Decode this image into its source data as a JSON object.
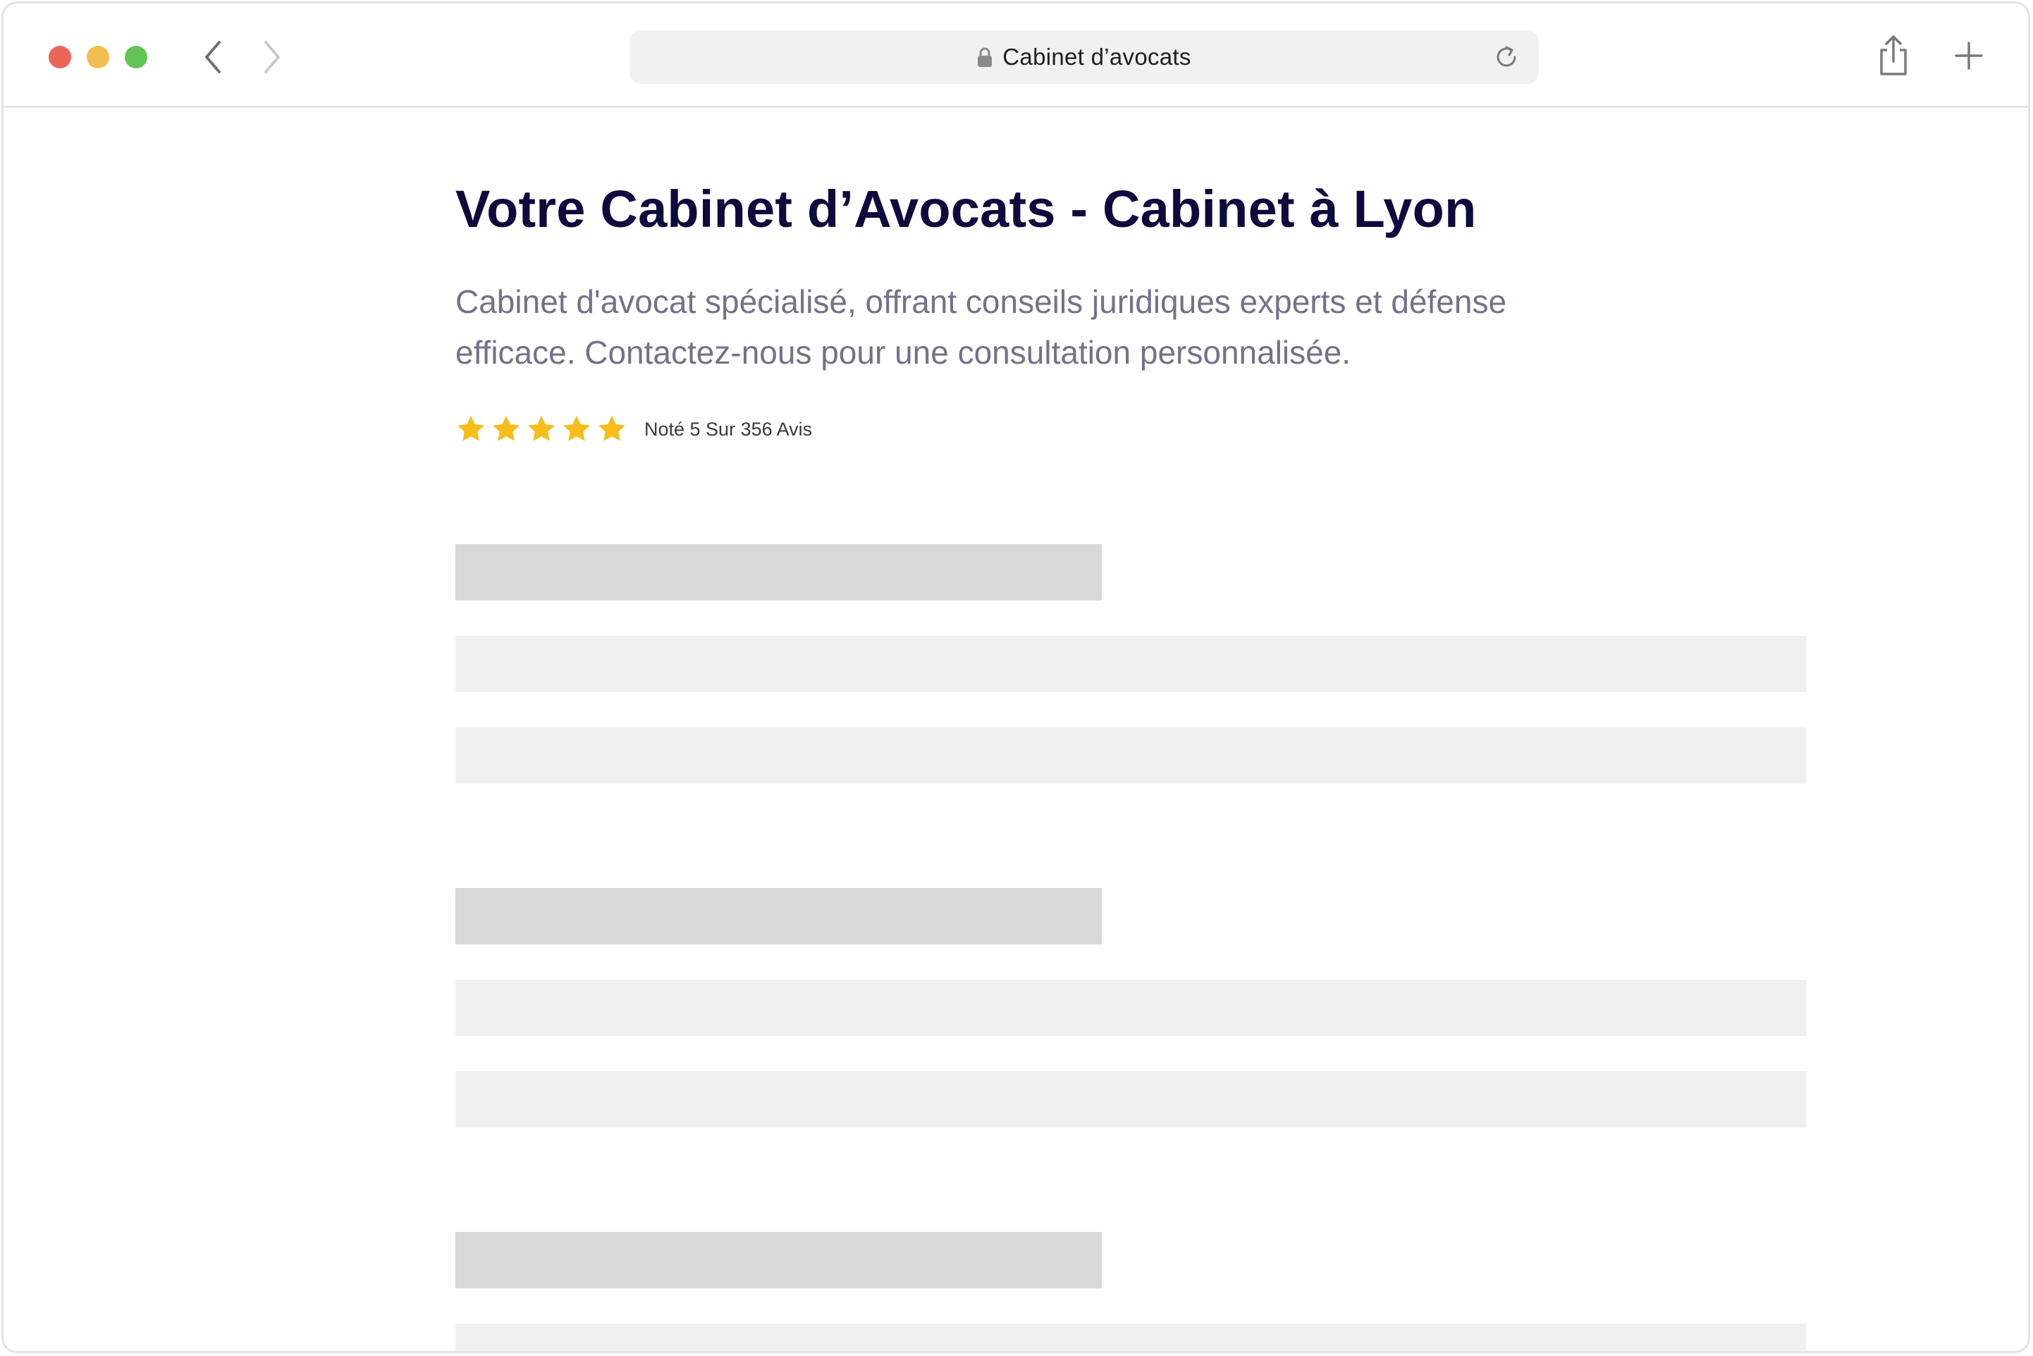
{
  "browser": {
    "address_text": "Cabinet d’avocats",
    "icons": {
      "back": "chevron-left-icon",
      "forward": "chevron-right-icon",
      "lock": "lock-icon",
      "reload": "reload-icon",
      "share": "share-icon",
      "new_tab": "plus-icon"
    }
  },
  "page": {
    "title": "Votre Cabinet d’Avocats - Cabinet à Lyon",
    "subtitle": "Cabinet d'avocat spécialisé, offrant conseils juridiques experts et défense efficace. Contactez-nous pour une consultation personnalisée.",
    "rating": {
      "stars": 5,
      "text": "Noté 5 Sur 356 Avis"
    }
  },
  "colors": {
    "title": "#0f0a3d",
    "subtitle": "#747189",
    "star": "#f7bd1a",
    "skeleton_dark": "#d8d8d8",
    "skeleton_light": "#f0f0f0"
  }
}
